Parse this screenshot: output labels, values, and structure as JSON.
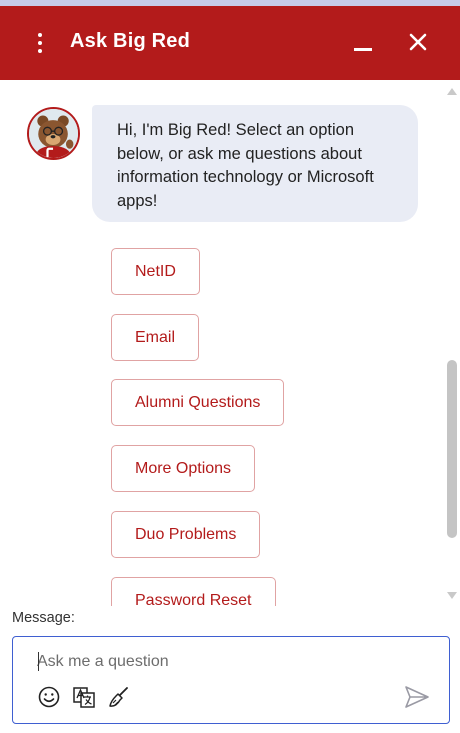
{
  "header": {
    "title": "Ask Big Red",
    "menu_icon": "kebab-menu-icon",
    "minimize_icon": "minimize-icon",
    "close_icon": "close-icon",
    "background": "#b31b1b"
  },
  "chat": {
    "bot_message": "Hi, I'm Big Red! Select an option below, or ask me questions about information technology or Microsoft apps!",
    "avatar": "bear-mascot-avatar",
    "options": [
      {
        "label": "NetID"
      },
      {
        "label": "Email"
      },
      {
        "label": "Alumni Questions"
      },
      {
        "label": "More Options"
      },
      {
        "label": "Duo Problems"
      },
      {
        "label": "Password Reset"
      }
    ]
  },
  "composer": {
    "label": "Message:",
    "placeholder": "Ask me a question",
    "value": "",
    "tools": [
      "emoji-icon",
      "translate-icon",
      "clear-icon"
    ],
    "send_icon": "send-icon"
  },
  "colors": {
    "accent": "#b31b1b",
    "bubble": "#e9ecf5",
    "option_border": "#e0a3a3",
    "input_border": "#3f5fd1"
  }
}
